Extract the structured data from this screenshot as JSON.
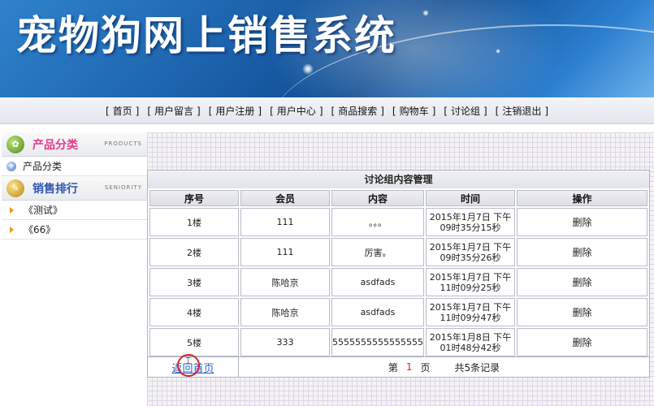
{
  "banner": {
    "title": "宠物狗网上销售系统"
  },
  "nav": {
    "items": [
      {
        "label": "首页"
      },
      {
        "label": "用户留言"
      },
      {
        "label": "用户注册"
      },
      {
        "label": "用户中心"
      },
      {
        "label": "商品搜索"
      },
      {
        "label": "购物车"
      },
      {
        "label": "讨论组"
      },
      {
        "label": "注销退出"
      }
    ],
    "bracket_open": "[",
    "bracket_close": "]"
  },
  "sidebar": {
    "products": {
      "title": "产品分类",
      "subtitle": "PRODUCTS",
      "item": "产品分类",
      "icon": "category-badge-icon"
    },
    "ranking": {
      "title": "销售排行",
      "subtitle": "SENIORITY",
      "icon": "ranking-badge-icon",
      "items": [
        {
          "label": "《测试》"
        },
        {
          "label": "《66》"
        }
      ]
    }
  },
  "board": {
    "title": "讨论组内容管理",
    "headers": [
      "序号",
      "会员",
      "内容",
      "时间",
      "操作"
    ],
    "rows": [
      {
        "floor": "1楼",
        "member": "111",
        "content": "。。。",
        "time_line1": "2015年1月7日 下午",
        "time_line2": "09时35分15秒",
        "action": "删除"
      },
      {
        "floor": "2楼",
        "member": "111",
        "content": "厉害。",
        "time_line1": "2015年1月7日 下午",
        "time_line2": "09时35分26秒",
        "action": "删除"
      },
      {
        "floor": "3楼",
        "member": "陈哈京",
        "content": "asdfads",
        "time_line1": "2015年1月7日 下午",
        "time_line2": "11时09分25秒",
        "action": "删除"
      },
      {
        "floor": "4楼",
        "member": "陈哈京",
        "content": "asdfads",
        "time_line1": "2015年1月7日 下午",
        "time_line2": "11时09分47秒",
        "action": "删除"
      },
      {
        "floor": "5楼",
        "member": "333",
        "content": "5555555555555555",
        "time_line1": "2015年1月8日 下午",
        "time_line2": "01时48分42秒",
        "action": "删除"
      }
    ]
  },
  "footer": {
    "back_link": "返回首页",
    "page_prefix": "第",
    "page_number": "1",
    "page_suffix": "页",
    "total": "共5条记录"
  },
  "colors": {
    "accent_red": "#d4242a",
    "link_blue": "#2a62c4",
    "banner_blue": "#1d63ad"
  }
}
